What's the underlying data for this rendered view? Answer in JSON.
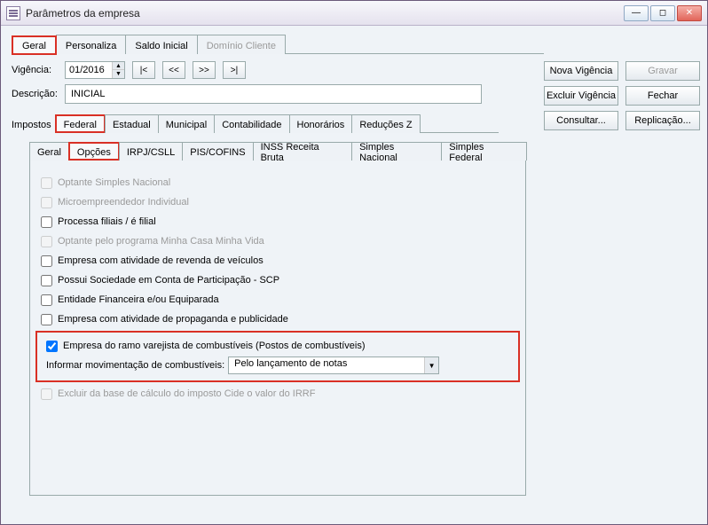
{
  "window_title": "Parâmetros da empresa",
  "main_tabs": {
    "geral": "Geral",
    "personaliza": "Personaliza",
    "saldo_inicial": "Saldo Inicial",
    "dominio_cliente": "Domínio Cliente"
  },
  "vigencia": {
    "label": "Vigência:",
    "value": "01/2016",
    "first": "|<",
    "prev": "<<",
    "next": ">>",
    "last": ">|"
  },
  "descricao": {
    "label": "Descrição:",
    "value": "INICIAL"
  },
  "side_buttons_a": {
    "nova": "Nova Vigência",
    "excluir": "Excluir Vigência",
    "consultar": "Consultar..."
  },
  "side_buttons_b": {
    "gravar": "Gravar",
    "fechar": "Fechar",
    "replicacao": "Replicação..."
  },
  "impostos": {
    "label": "Impostos",
    "tabs": {
      "federal": "Federal",
      "estadual": "Estadual",
      "municipal": "Municipal",
      "contabilidade": "Contabilidade",
      "honorarios": "Honorários",
      "reducoesz": "Reduções Z"
    }
  },
  "subtabs": {
    "geral": "Geral",
    "opcoes": "Opções",
    "irpj": "IRPJ/CSLL",
    "piscofins": "PIS/COFINS",
    "inss": "INSS Receita Bruta",
    "simples_nacional": "Simples Nacional",
    "simples_federal": "Simples Federal"
  },
  "checks": {
    "optante_simples": "Optante Simples Nacional",
    "mei": "Microempreendedor Individual",
    "processa_filiais": "Processa filiais / é filial",
    "minha_casa": "Optante pelo programa Minha Casa Minha Vida",
    "revenda_veiculos": "Empresa com atividade de revenda de veículos",
    "scp": "Possui Sociedade em Conta de Participação - SCP",
    "entidade_fin": "Entidade Financeira e/ou Equiparada",
    "propaganda": "Empresa com atividade de propaganda e publicidade",
    "combustiveis": "Empresa do ramo varejista de combustíveis (Postos de combustíveis)",
    "informar_mov_label": "Informar movimentação de combustíveis:",
    "informar_mov_value": "Pelo lançamento de notas",
    "excluir_cide": "Excluir da base de cálculo do imposto Cide o valor do IRRF"
  }
}
